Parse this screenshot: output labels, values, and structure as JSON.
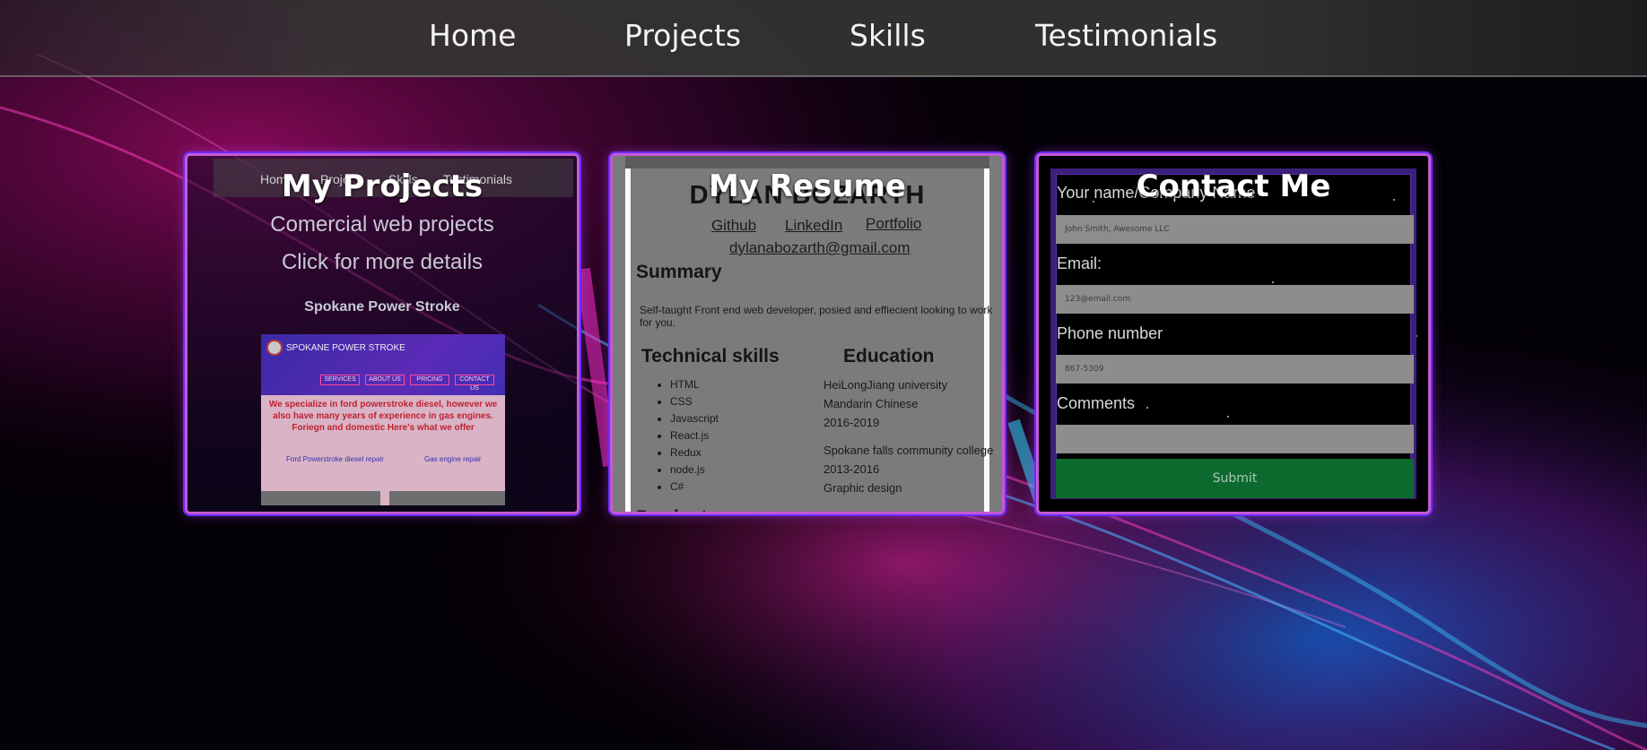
{
  "nav": {
    "links": [
      "Home",
      "Projects",
      "Skills",
      "Testimonials"
    ]
  },
  "cards": {
    "projects": {
      "title": "My Projects",
      "preview": {
        "mini_nav": [
          "Home",
          "Proje",
          "Skills",
          "Testimonials"
        ],
        "subtitle": "Comercial web projects",
        "hint": "Click for more details",
        "site_name": "Spokane Power Stroke",
        "site_logo_text": "SPOKANE POWER STROKE",
        "site_menu": [
          "SERVICES",
          "ABOUT US",
          "PRICING",
          "CONTACT US"
        ],
        "site_body": "We specialize in ford powerstroke diesel, however we also have many years of experience in gas engines. Foriegn and domestic Here's what we offer",
        "site_links": [
          "Ford Powerstroke diesel repair",
          "Gas engine repair"
        ]
      }
    },
    "resume": {
      "title": "My Resume",
      "preview": {
        "name": "DYLAN BOZARTH",
        "links": [
          "Github",
          "LinkedIn",
          "Portfolio"
        ],
        "email": "dylanabozarth@gmail.com",
        "summary_heading": "Summary",
        "summary": "Self-taught Front end web developer, posied and effiecient looking to work for you.",
        "skills_heading": "Technical skills",
        "skills": [
          "HTML",
          "CSS",
          "Javascript",
          "React.js",
          "Redux",
          "node.js",
          "C#"
        ],
        "education_heading": "Education",
        "education": [
          [
            "HeiLongJiang university",
            "Mandarin Chinese",
            "2016-2019"
          ],
          [
            "Spokane falls community college",
            "2013-2016",
            "Graphic design"
          ]
        ],
        "next_heading": "Product"
      }
    },
    "contact": {
      "title": "Contact Me",
      "fields": {
        "name_label": "Your name/Company Name",
        "name_placeholder": "John Smith, Awesome LLC",
        "email_label": "Email:",
        "email_placeholder": "123@email.com",
        "phone_label": "Phone number",
        "phone_placeholder": "867-5309",
        "comments_label": "Comments",
        "comments_placeholder": ""
      },
      "submit_label": "Submit"
    }
  },
  "colors": {
    "card_border": "#c45ad4",
    "card_glow": "#6a2cff",
    "submit_bg": "#0c6a2f",
    "nav_bg": "#343434"
  }
}
